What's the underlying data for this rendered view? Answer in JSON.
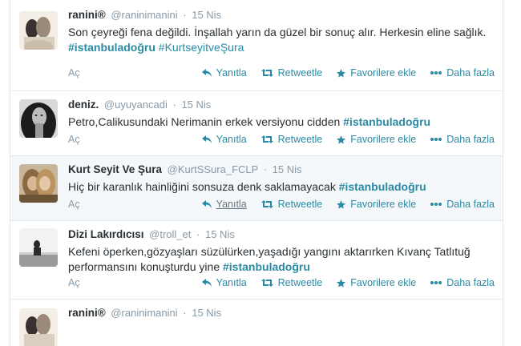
{
  "action_labels": {
    "expand": "Aç",
    "reply": "Yanıtla",
    "retweet": "Retweetle",
    "favorite": "Favorilere ekle",
    "more": "Daha fazla"
  },
  "icons": [
    "reply-icon",
    "retweet-icon",
    "star-icon",
    "more-dots-icon"
  ],
  "colors": {
    "link": "#2a8aa3",
    "muted": "#8899a6",
    "text": "#292f33"
  },
  "tweets": [
    {
      "fullname": "ranini®",
      "username": "@raninimanini",
      "time": "15 Nis",
      "text": "Son çeyreği fena değildi. İnşallah yarın da güzel bir sonuç alır. Herkesin eline sağlık.",
      "hashtag1": "#istanbuladoğru",
      "hashtag2": "#KurtseyitveŞura"
    },
    {
      "fullname": "deniz.",
      "username": "@uyuyancadi",
      "time": "15 Nis",
      "text": "Petro,Calikusundaki Nerimanin erkek versiyonu cidden",
      "hashtag1": "#istanbuladoğru"
    },
    {
      "fullname": "Kurt Seyit Ve Şura",
      "username": "@KurtSSura_FCLP",
      "time": "15 Nis",
      "text": "Hiç bir karanlık hainliğini sonsuza denk saklamayacak",
      "hashtag1": "#istanbuladoğru"
    },
    {
      "fullname": "Dizi Lakırdıcısı",
      "username": "@troll_et",
      "time": "15 Nis",
      "text": "Kefeni öperken,gözyaşları süzülürken,yaşadığı yangını aktarırken Kıvanç Tatlıtuğ performansını konuşturdu yine",
      "hashtag1": "#istanbuladoğru"
    },
    {
      "fullname": "ranini®",
      "username": "@raninimanini",
      "time": "15 Nis"
    }
  ]
}
